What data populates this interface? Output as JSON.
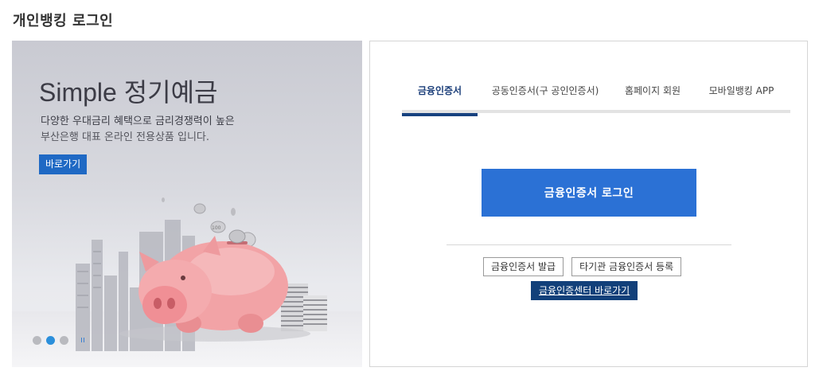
{
  "page": {
    "title": "개인뱅킹 로그인"
  },
  "banner": {
    "headline": "Simple 정기예금",
    "desc_line1": "다양한 우대금리 혜택으로 금리경쟁력이 높은",
    "desc_line2": "부산은행 대표 온라인 전용상품 입니다.",
    "cta_label": "바로가기",
    "coin_label": "100",
    "slides": {
      "count": 3,
      "active_index": 1
    },
    "colors": {
      "cta": "#1f69c4",
      "active_dot": "#2b8fdb",
      "pig": "#f2a3a6"
    }
  },
  "login": {
    "tabs": [
      {
        "label": "금융인증서",
        "active": true
      },
      {
        "label": "공동인증서(구 공인인증서)",
        "active": false
      },
      {
        "label": "홈페이지 회원",
        "active": false
      },
      {
        "label": "모바일뱅킹 APP",
        "active": false
      }
    ],
    "primary_button": "금융인증서 로그인",
    "secondary_buttons": [
      "금융인증서 발급",
      "타기관 금융인증서 등록"
    ],
    "center_link": "금융인증센터 바로가기",
    "colors": {
      "primary": "#2b71d5",
      "tab_active": "#17427f",
      "center_link": "#12407a"
    }
  }
}
